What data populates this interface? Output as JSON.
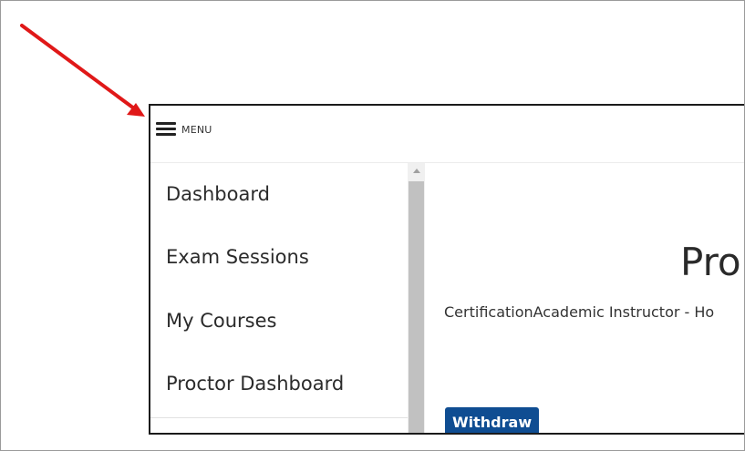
{
  "menu": {
    "label": "MENU"
  },
  "sidebar": {
    "items": [
      {
        "label": "Dashboard"
      },
      {
        "label": "Exam Sessions"
      },
      {
        "label": "My Courses"
      },
      {
        "label": "Proctor Dashboard"
      }
    ]
  },
  "main": {
    "title": "Pro",
    "subtitle": "CertificationAcademic Instructor - Ho",
    "withdraw_label": "Withdraw"
  },
  "annotation": {
    "arrow_color": "#e01818"
  },
  "colors": {
    "primary_button": "#0f4d92",
    "scroll_thumb": "#c1c1c1"
  }
}
